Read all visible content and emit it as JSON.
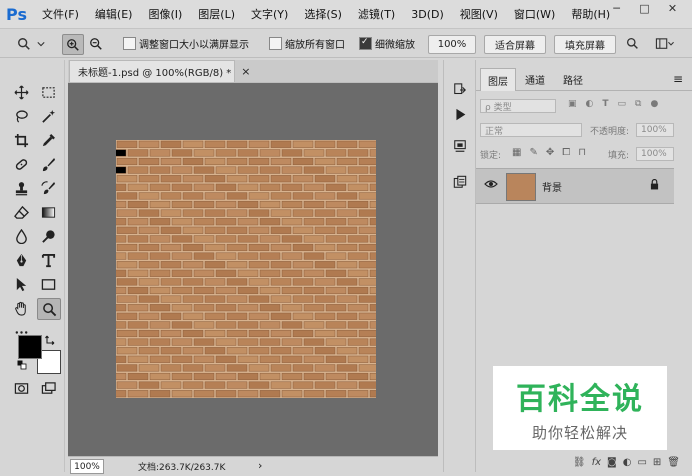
{
  "app": {
    "logo": "Ps"
  },
  "menu": [
    "文件(F)",
    "编辑(E)",
    "图像(I)",
    "图层(L)",
    "文字(Y)",
    "选择(S)",
    "滤镜(T)",
    "3D(D)",
    "视图(V)",
    "窗口(W)",
    "帮助(H)"
  ],
  "window_controls": {
    "minimize": "─",
    "maximize": "□",
    "close": "✕"
  },
  "options": {
    "resize_windows_label": "调整窗口大小以满屏显示",
    "zoom_all_label": "缩放所有窗口",
    "scrubby_zoom_label": "细微缩放",
    "scrubby_zoom_checked": true,
    "zoom_value": "100%",
    "fit_screen_label": "适合屏幕",
    "fill_screen_label": "填充屏幕"
  },
  "document": {
    "tab_title": "未标题-1.psd @ 100%(RGB/8) *",
    "tab_close": "×",
    "zoom": "100%",
    "doc_info": "文档:263.7K/263.7K",
    "status_arrow": "›"
  },
  "colors": {
    "foreground": "#000000",
    "background": "#ffffff",
    "brick": "#b9855c",
    "mortar": "#d8b38f",
    "canvas_bg": "#6b6b6b",
    "watermark_green": "#2fb35a"
  },
  "layers_panel": {
    "tabs": [
      "图层",
      "通道",
      "路径"
    ],
    "active_tab": "图层",
    "filter_label": "ρ 类型",
    "blend_mode": "正常",
    "opacity_label": "不透明度:",
    "opacity_value": "100%",
    "lock_label": "锁定:",
    "fill_label": "填充:",
    "fill_value": "100%",
    "layers": [
      {
        "name": "背景",
        "visible": true,
        "locked": true
      }
    ],
    "footer_fx": "fx"
  },
  "watermark": {
    "title": "百科全说",
    "subtitle": "助你轻松解决"
  }
}
